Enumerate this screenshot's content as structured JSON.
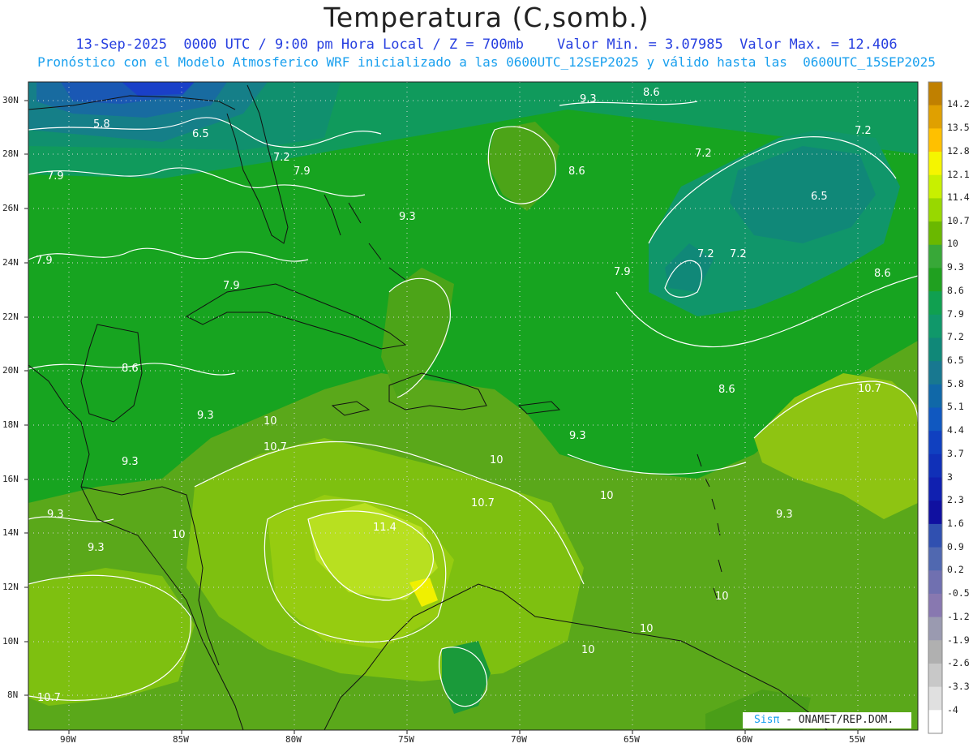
{
  "header": {
    "title": "Temperatura (C,somb.)",
    "line1": "13-Sep-2025  0000 UTC / 9:00 pm Hora Local / Z = 700mb    Valor Min. = 3.07985  Valor Max. = 12.406",
    "line2": "Pronóstico con el Modelo Atmosferico WRF inicializado a las 0600UTC_12SEP2025 y válido hasta las  0600UTC_15SEP2025"
  },
  "axes": {
    "lat_labels": [
      "30N",
      "28N",
      "26N",
      "24N",
      "22N",
      "20N",
      "18N",
      "16N",
      "14N",
      "12N",
      "10N",
      "8N"
    ],
    "lon_labels": [
      "90W",
      "85W",
      "80W",
      "75W",
      "70W",
      "65W",
      "60W",
      "55W"
    ]
  },
  "colorbar": {
    "labels": [
      "14.2",
      "13.5",
      "12.8",
      "12.1",
      "11.4",
      "10.7",
      "10",
      "9.3",
      "8.6",
      "7.9",
      "7.2",
      "6.5",
      "5.8",
      "5.1",
      "4.4",
      "3.7",
      "3",
      "2.3",
      "1.6",
      "0.9",
      "0.2",
      "-0.5",
      "-1.2",
      "-1.9",
      "-2.6",
      "-3.3",
      "-4"
    ],
    "colors": [
      "#c08000",
      "#e0a000",
      "#ffc000",
      "#f5f500",
      "#c8f000",
      "#98d800",
      "#6ab800",
      "#38a838",
      "#20a020",
      "#10a050",
      "#10986a",
      "#108878",
      "#187890",
      "#1068a8",
      "#1058c0",
      "#1040c0",
      "#1030b8",
      "#1020b0",
      "#1010a0",
      "#3050b0",
      "#5068b0",
      "#7070b0",
      "#8878b0",
      "#9a9ab0",
      "#b0b0b0",
      "#c8c8c8",
      "#e0e0e0",
      "#ffffff"
    ]
  },
  "contour_labels": [
    "5.8",
    "6.5",
    "7.2",
    "7.9",
    "7.9",
    "7.9",
    "9.3",
    "8.6",
    "9.3",
    "8.6",
    "7.2",
    "6.5",
    "7.2",
    "8.6",
    "7.9",
    "7.2",
    "8.6",
    "10.7",
    "8.6",
    "9.3",
    "9.3",
    "10",
    "10.7",
    "10",
    "10.7",
    "11.4",
    "10",
    "9.3",
    "9.3",
    "9.3",
    "10",
    "10",
    "10",
    "10",
    "10.7",
    "7.9",
    "9.3",
    "7.2"
  ],
  "credit": {
    "sis": "Sisπ",
    "org": "- ONAMET/REP.DOM."
  },
  "values": {
    "min": 3.07985,
    "max": 12.406
  }
}
